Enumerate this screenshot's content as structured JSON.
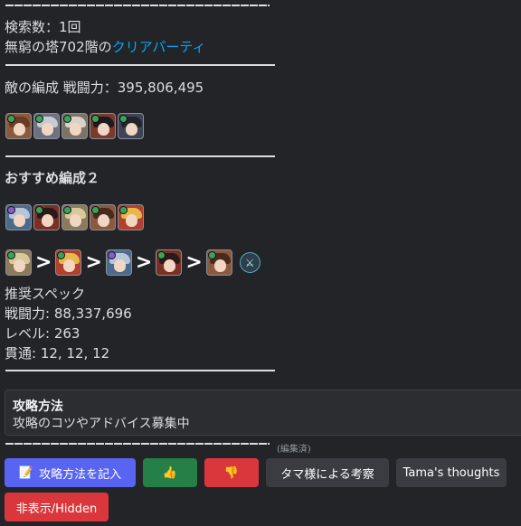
{
  "message": {
    "search_count": "検索数：1回",
    "tower_prefix": "無窮の塔702階の",
    "tower_link": "クリアパーティ",
    "enemy_power": "敵の編成 戦闘力：395,806,495",
    "recommend_title": "おすすめ編成２",
    "spec_title": "推奨スペック",
    "power": "戦闘力: 88,337,696",
    "level": "レベル: 263",
    "penetration": "貫通: 12, 12, 12",
    "edited": "(編集済)"
  },
  "enemy_team": [
    {
      "name": "char-1",
      "badge": "#3aa35a",
      "hair": "#6b3b22",
      "bg": "#8a5a3c"
    },
    {
      "name": "char-2",
      "badge": "#3aa35a",
      "hair": "#c9c9d2",
      "bg": "#6d7180"
    },
    {
      "name": "char-3",
      "badge": "#3aa35a",
      "hair": "#d8d2c8",
      "bg": "#7b7466"
    },
    {
      "name": "char-4",
      "badge": "#3aa35a",
      "hair": "#1b1b1e",
      "bg": "#7a3a2a"
    },
    {
      "name": "char-5",
      "badge": "#3aa35a",
      "hair": "#22242c",
      "bg": "#3e4356"
    }
  ],
  "recommended_team": [
    {
      "name": "char-a",
      "badge": "#8b5cc9",
      "hair": "#b7c7d8",
      "bg": "#4c6a8c"
    },
    {
      "name": "char-b",
      "badge": "#3aa35a",
      "hair": "#2a1a18",
      "bg": "#7a3024"
    },
    {
      "name": "char-c",
      "badge": "#3aa35a",
      "hair": "#d9c89a",
      "bg": "#8c7b5a"
    },
    {
      "name": "char-d",
      "badge": "#3aa35a",
      "hair": "#4a2a1c",
      "bg": "#8a5a40"
    },
    {
      "name": "char-e",
      "badge": "#3aa35a",
      "hair": "#e8b84a",
      "bg": "#b04030"
    }
  ],
  "order_team": [
    {
      "name": "order-1",
      "badge": "#3aa35a",
      "hair": "#d9c89a",
      "bg": "#8c7b5a"
    },
    {
      "name": "order-2",
      "badge": "#3aa35a",
      "hair": "#e8b84a",
      "bg": "#b04030"
    },
    {
      "name": "order-3",
      "badge": "#8b5cc9",
      "hair": "#b7c7d8",
      "bg": "#4c6a8c"
    },
    {
      "name": "order-4",
      "badge": "#3aa35a",
      "hair": "#2a1a18",
      "bg": "#7a3024"
    },
    {
      "name": "order-5",
      "badge": "#3aa35a",
      "hair": "#4a2a1c",
      "bg": "#8a5a40"
    }
  ],
  "embed": {
    "title": "攻略方法",
    "description": "攻略のコツやアドバイス募集中"
  },
  "buttons": {
    "write_strategy": "攻略方法を記入",
    "write_icon": "📝",
    "thumbs_up": "👍",
    "thumbs_down": "👎",
    "tama_analysis": "タマ様による考察",
    "tama_thoughts": "Tama's thoughts",
    "hide": "非表示/Hidden"
  }
}
